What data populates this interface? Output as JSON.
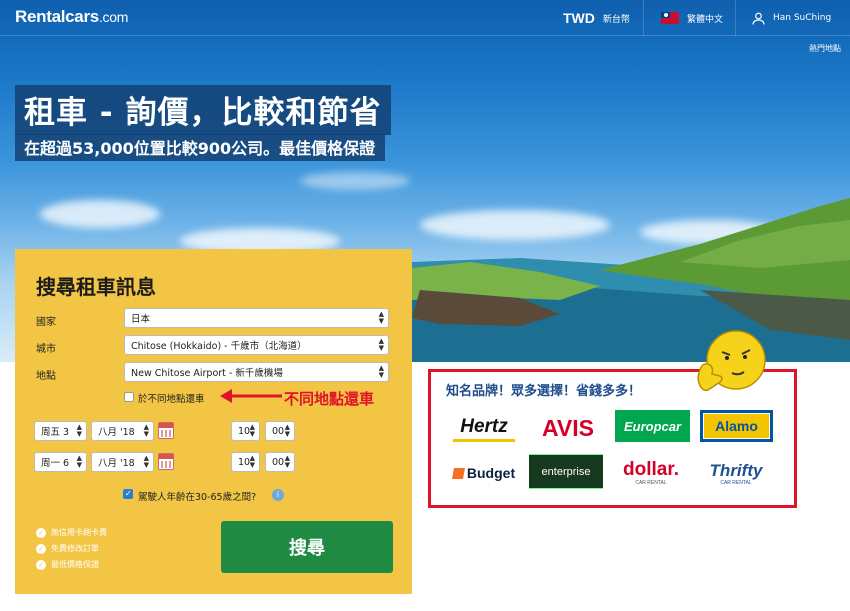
{
  "nav": {
    "logo": "Rentalcars",
    "logo_suffix": ".com",
    "currency_code": "TWD",
    "currency_name": "新台幣",
    "language": "繁體中文",
    "user": "Han SuChing",
    "popular": "熱門地點"
  },
  "hero": {
    "title": "租車 - 詢價，比較和節省",
    "subtitle": "在超過53,000位置比較900公司。最佳價格保證"
  },
  "form": {
    "title": "搜尋租車訊息",
    "country_label": "國家",
    "country_value": "日本",
    "city_label": "城市",
    "city_value": "Chitose (Hokkaido) - 千歲市（北海道）",
    "location_label": "地點",
    "location_value": "New Chitose Airport - 新千歲機場",
    "return_diff_label": "於不同地點還車",
    "pickup_day": "周五 3",
    "pickup_month": "八月 '18",
    "pickup_hour": "10",
    "pickup_min": "00",
    "dropoff_day": "周一 6",
    "dropoff_month": "八月 '18",
    "dropoff_hour": "10",
    "dropoff_min": "00",
    "age_label": "駕駛人年齡在30-65歲之間?",
    "age_checked": true,
    "benefits": [
      "無信用卡刷卡費",
      "免費修改訂單",
      "最低價格保證"
    ],
    "search_label": "搜尋"
  },
  "annotation": {
    "callout": "不同地點還車",
    "brands_title": "知名品牌！眾多選擇！省錢多多！"
  },
  "brands": {
    "hertz": "Hertz",
    "avis": "AVIS",
    "europcar": "Europcar",
    "alamo": "Alamo",
    "budget": "Budget",
    "enterprise": "enterprise",
    "dollar": "dollar.",
    "dollar_sub": "CAR RENTAL",
    "thrifty": "Thrifty",
    "thrifty_sub": "CAR RENTAL"
  },
  "colors": {
    "form_bg": "#f3c544",
    "search_btn": "#1f8a44",
    "accent_red": "#e0132b",
    "title_blue": "#1f4e8c"
  }
}
